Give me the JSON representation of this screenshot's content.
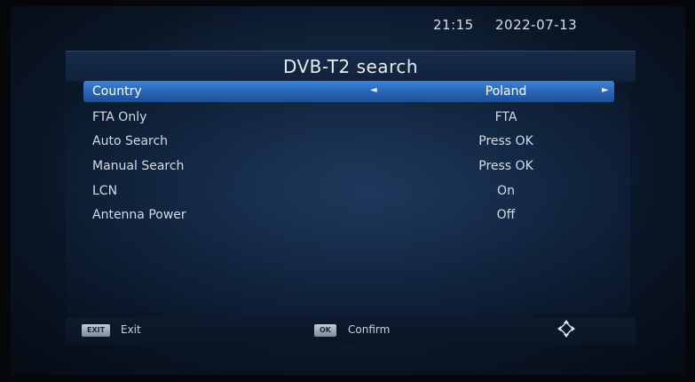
{
  "status": {
    "time": "21:15",
    "date": "2022-07-13"
  },
  "title": "DVB-T2 search",
  "menu": {
    "items": [
      {
        "label": "Country",
        "value": "Poland",
        "selected": true
      },
      {
        "label": "FTA Only",
        "value": "FTA"
      },
      {
        "label": "Auto Search",
        "value": "Press OK"
      },
      {
        "label": "Manual Search",
        "value": "Press OK"
      },
      {
        "label": "LCN",
        "value": "On"
      },
      {
        "label": "Antenna Power",
        "value": "Off"
      }
    ],
    "left_arrow": "◄",
    "right_arrow": "►"
  },
  "footer": {
    "exit_key": "EXIT",
    "exit_label": "Exit",
    "ok_key": "OK",
    "confirm_label": "Confirm",
    "nav_icon": "navigation-arrows-icon"
  }
}
